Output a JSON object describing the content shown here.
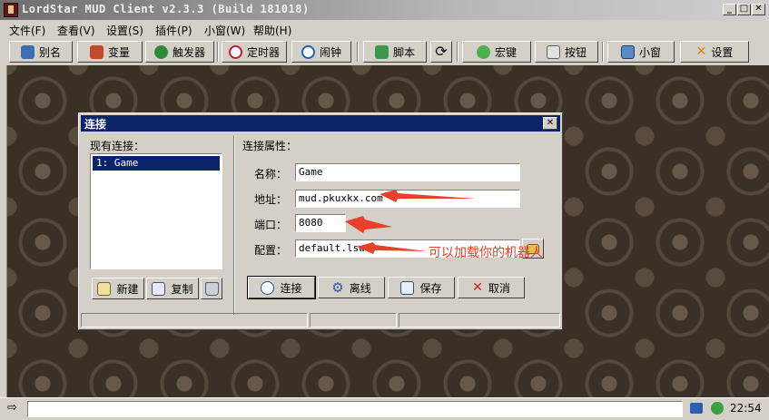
{
  "window": {
    "title": "LordStar MUD Client v2.3.3 (Build 181018)"
  },
  "menu": [
    "文件(F)",
    "查看(V)",
    "设置(S)",
    "插件(P)",
    "小窗(W)",
    "帮助(H)"
  ],
  "toolbar": {
    "alias": "别名",
    "variable": "变量",
    "trigger": "触发器",
    "timer": "定时器",
    "alarm": "闹钟",
    "script": "脚本",
    "macro": "宏键",
    "button": "按钮",
    "miniwin": "小窗",
    "settings": "设置"
  },
  "dialog": {
    "title": "连接",
    "existing_label": "现有连接：",
    "connections": [
      "1: Game"
    ],
    "props_label": "连接属性：",
    "name_label": "名称：",
    "name_value": "Game",
    "address_label": "地址：",
    "address_value": "mud.pkuxkx.com",
    "port_label": "端口：",
    "port_value": "8080",
    "config_label": "配置：",
    "config_value": "default.lsw",
    "btn_new": "新建",
    "btn_copy": "复制",
    "btn_connect": "连接",
    "btn_offline": "离线",
    "btn_save": "保存",
    "btn_cancel": "取消"
  },
  "annotation": {
    "text": "可以加载你的机器人",
    "color": "#e8402a"
  },
  "statusbar": {
    "clock": "22:54"
  },
  "colors": {
    "selection": "#0a246a",
    "face": "#d4d0c8"
  }
}
